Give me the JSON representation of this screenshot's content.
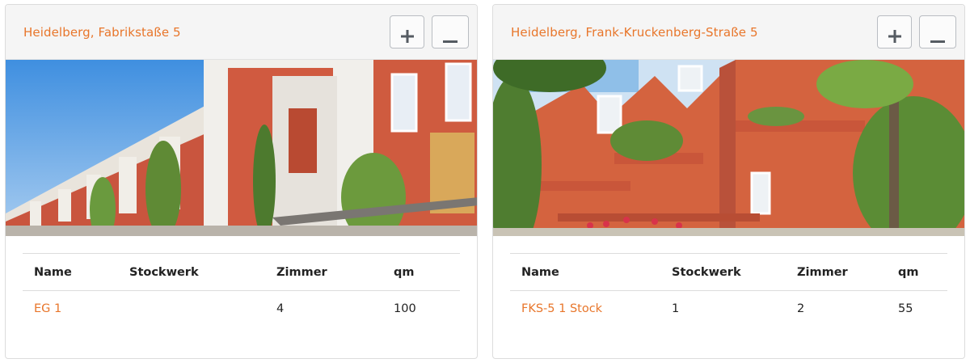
{
  "cards": [
    {
      "title": "Heidelberg, Fabrikstaße 5",
      "plus_icon": "plus-icon",
      "minus_icon": "minus-icon",
      "photo": "building-photo",
      "table": {
        "headers": [
          "Name",
          "Stockwerk",
          "Zimmer",
          "qm"
        ],
        "rows": [
          {
            "name": "EG 1",
            "stockwerk": "",
            "zimmer": "4",
            "qm": "100"
          }
        ]
      }
    },
    {
      "title": "Heidelberg, Frank-Kruckenberg-Straße 5",
      "plus_icon": "plus-icon",
      "minus_icon": "minus-icon",
      "photo": "building-photo",
      "table": {
        "headers": [
          "Name",
          "Stockwerk",
          "Zimmer",
          "qm"
        ],
        "rows": [
          {
            "name": "FKS-5 1 Stock",
            "stockwerk": "1",
            "zimmer": "2",
            "qm": "55"
          }
        ]
      }
    }
  ],
  "colors": {
    "accent": "#e8762b",
    "header_bg": "#f5f5f5",
    "border": "#dcdcdc"
  }
}
